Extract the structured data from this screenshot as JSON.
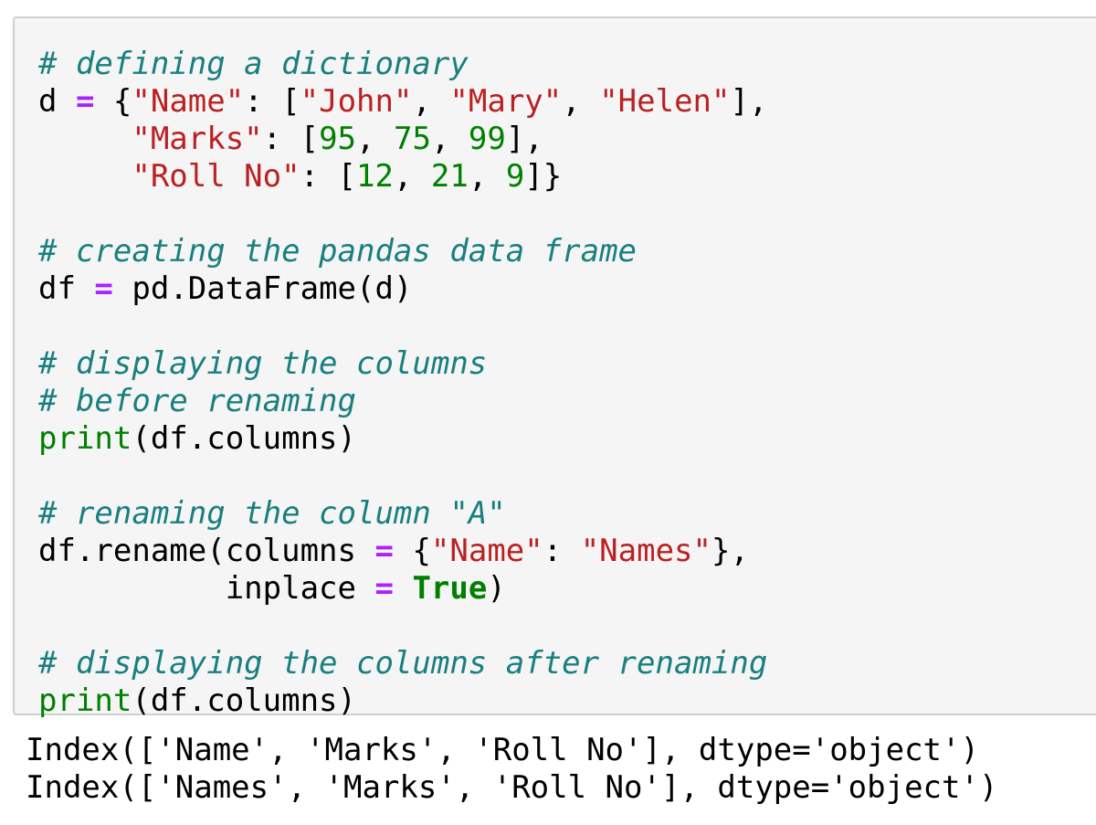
{
  "code_cell": {
    "lines": {
      "c1": "# defining a dictionary",
      "l2": {
        "a": "d ",
        "op": "=",
        "b": " {",
        "s1": "\"Name\"",
        "c": ": [",
        "s2": "\"John\"",
        "d": ", ",
        "s3": "\"Mary\"",
        "e": ", ",
        "s4": "\"Helen\"",
        "f": "],"
      },
      "l3": {
        "indent": "     ",
        "s1": "\"Marks\"",
        "a": ": [",
        "n1": "95",
        "b": ", ",
        "n2": "75",
        "c": ", ",
        "n3": "99",
        "d": "],"
      },
      "l4": {
        "indent": "     ",
        "s1": "\"Roll No\"",
        "a": ": [",
        "n1": "12",
        "b": ", ",
        "n2": "21",
        "c": ", ",
        "n3": "9",
        "d": "]}"
      },
      "c2": "# creating the pandas data frame",
      "l6": {
        "a": "df ",
        "op": "=",
        "b": " pd.DataFrame(d)"
      },
      "c3": "# displaying the columns",
      "c4": "# before renaming",
      "l9": {
        "fn": "print",
        "a": "(df.columns)"
      },
      "c5": "# renaming the column \"A\"",
      "l11": {
        "a": "df.rename(columns ",
        "op": "=",
        "b": " {",
        "s1": "\"Name\"",
        "c": ": ",
        "s2": "\"Names\"",
        "d": "},"
      },
      "l12": {
        "indent": "          ",
        "a": "inplace ",
        "op": "=",
        "b": " ",
        "kw": "True",
        "c": ")"
      },
      "c6": "# displaying the columns after renaming",
      "l14": {
        "fn": "print",
        "a": "(df.columns)"
      }
    }
  },
  "output": {
    "line1": "Index(['Name', 'Marks', 'Roll No'], dtype='object')",
    "line2": "Index(['Names', 'Marks', 'Roll No'], dtype='object')"
  },
  "colors": {
    "comment": "#1a7f7f",
    "string": "#ba2121",
    "number": "#008000",
    "operator": "#aa22ff",
    "builtin": "#008000",
    "cell_background": "#f5f5f5",
    "cell_border": "#cfcfcf"
  }
}
